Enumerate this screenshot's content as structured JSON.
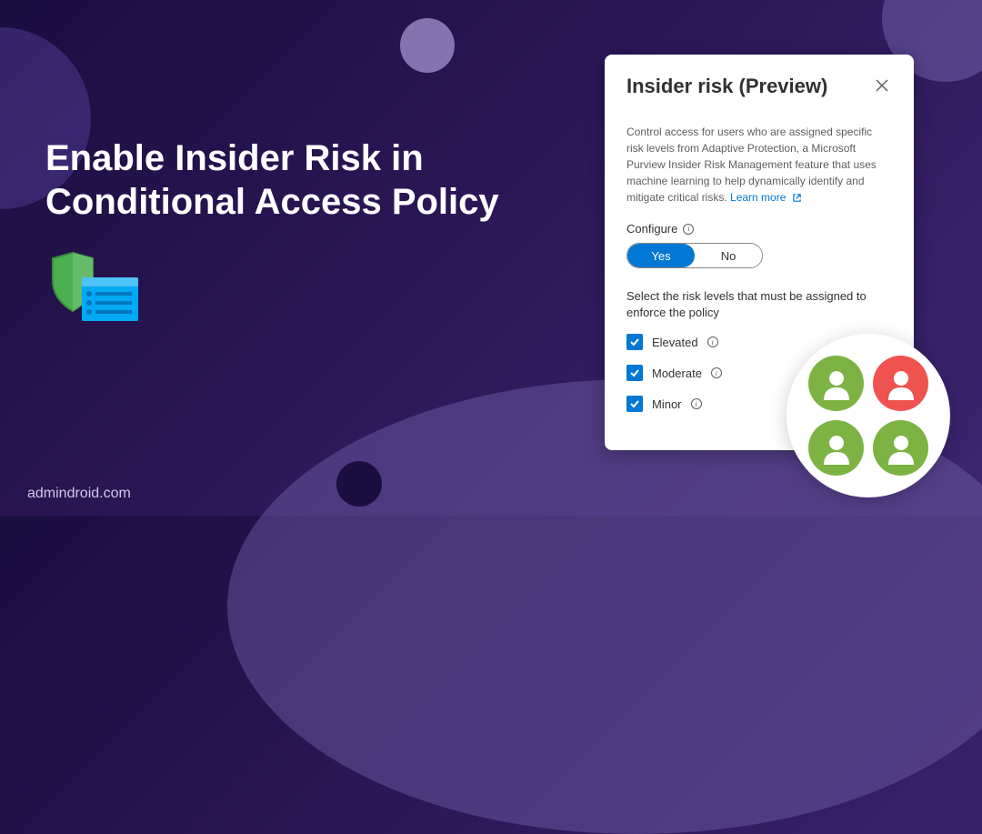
{
  "heading": "Enable Insider Risk in Conditional Access Policy",
  "footer": "admindroid.com",
  "panel": {
    "title": "Insider risk (Preview)",
    "description": "Control access for users who are assigned specific risk levels from Adaptive Protection, a Microsoft Purview Insider Risk Management feature that uses machine learning to help dynamically identify and mitigate critical risks.",
    "learn_more": "Learn more",
    "configure_label": "Configure",
    "toggle": {
      "yes": "Yes",
      "no": "No",
      "selected": "yes"
    },
    "risk_levels_label": "Select the risk levels that must be assigned to enforce the policy",
    "risk_levels": [
      {
        "label": "Elevated",
        "checked": true
      },
      {
        "label": "Moderate",
        "checked": true
      },
      {
        "label": "Minor",
        "checked": true
      }
    ]
  },
  "user_avatars": [
    {
      "color": "green"
    },
    {
      "color": "red"
    },
    {
      "color": "green"
    },
    {
      "color": "green"
    }
  ]
}
